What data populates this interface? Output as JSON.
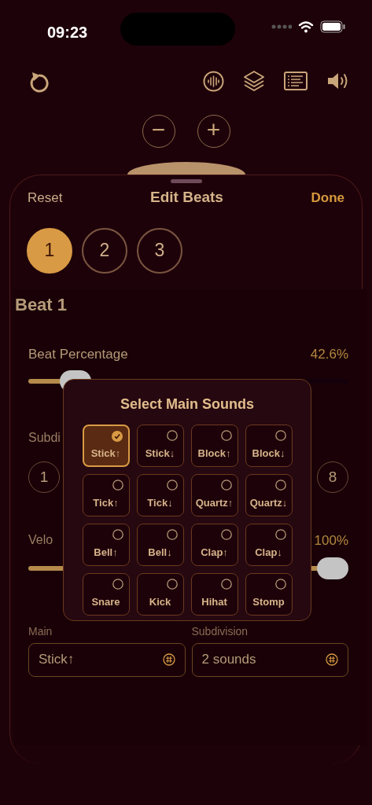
{
  "status_bar": {
    "time": "09:23"
  },
  "toolbar": {
    "zoom_buttons": [
      "−",
      "+"
    ]
  },
  "sheet": {
    "title": "Edit Beats",
    "reset": "Reset",
    "done": "Done",
    "beats": [
      {
        "label": "1",
        "selected": true
      },
      {
        "label": "2",
        "selected": false
      },
      {
        "label": "3",
        "selected": false
      }
    ],
    "section_title": "Beat 1",
    "beat_percentage": {
      "label": "Beat Percentage",
      "reading": "42.6%",
      "level": 0.11
    },
    "subdivisions": {
      "label": "Subdi",
      "buttons": [
        "1",
        "8"
      ]
    },
    "velocity": {
      "label": "Velo",
      "reading": "100%",
      "level": 1
    },
    "main": {
      "label": "Main",
      "value": "Stick↑"
    },
    "subdivision": {
      "label": "Subdivision",
      "value": "2 sounds"
    }
  },
  "popover": {
    "title": "Select Main Sounds",
    "sounds": [
      {
        "label": "Stick↑",
        "selected": true
      },
      {
        "label": "Stick↓",
        "selected": false
      },
      {
        "label": "Block↑",
        "selected": false
      },
      {
        "label": "Block↓",
        "selected": false
      },
      {
        "label": "Tick↑",
        "selected": false
      },
      {
        "label": "Tick↓",
        "selected": false
      },
      {
        "label": "Quartz↑",
        "selected": false
      },
      {
        "label": "Quartz↓",
        "selected": false
      },
      {
        "label": "Bell↑",
        "selected": false
      },
      {
        "label": "Bell↓",
        "selected": false
      },
      {
        "label": "Clap↑",
        "selected": false
      },
      {
        "label": "Clap↓",
        "selected": false
      },
      {
        "label": "Snare",
        "selected": false
      },
      {
        "label": "Kick",
        "selected": false
      },
      {
        "label": "Hihat",
        "selected": false
      },
      {
        "label": "Stomp",
        "selected": false
      }
    ]
  }
}
